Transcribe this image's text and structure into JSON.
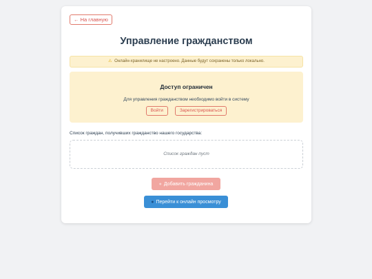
{
  "nav": {
    "back_label": "← На главную"
  },
  "page": {
    "title": "Управление гражданством"
  },
  "warning": {
    "icon": "warning-icon",
    "text": "Онлайн-хранилище не настроено. Данные будут сохранены только локально."
  },
  "access": {
    "title": "Доступ ограничен",
    "message": "Для управления гражданством необходимо войти в систему",
    "login_label": "Войти",
    "register_label": "Зарегистрироваться"
  },
  "citizens": {
    "caption": "Список граждан, получивших гражданство нашего государства:",
    "empty_text": "Список граждан пуст"
  },
  "actions": {
    "add_label": "Добавить гражданина",
    "add_icon": "user-icon",
    "online_label": "Перейти к онлайн просмотру",
    "online_icon": "people-icon"
  },
  "colors": {
    "danger": "#d9534f",
    "warning_bg": "#fdf1cf",
    "primary": "#3a8fd6",
    "disabled_danger": "#f1a6a0"
  }
}
